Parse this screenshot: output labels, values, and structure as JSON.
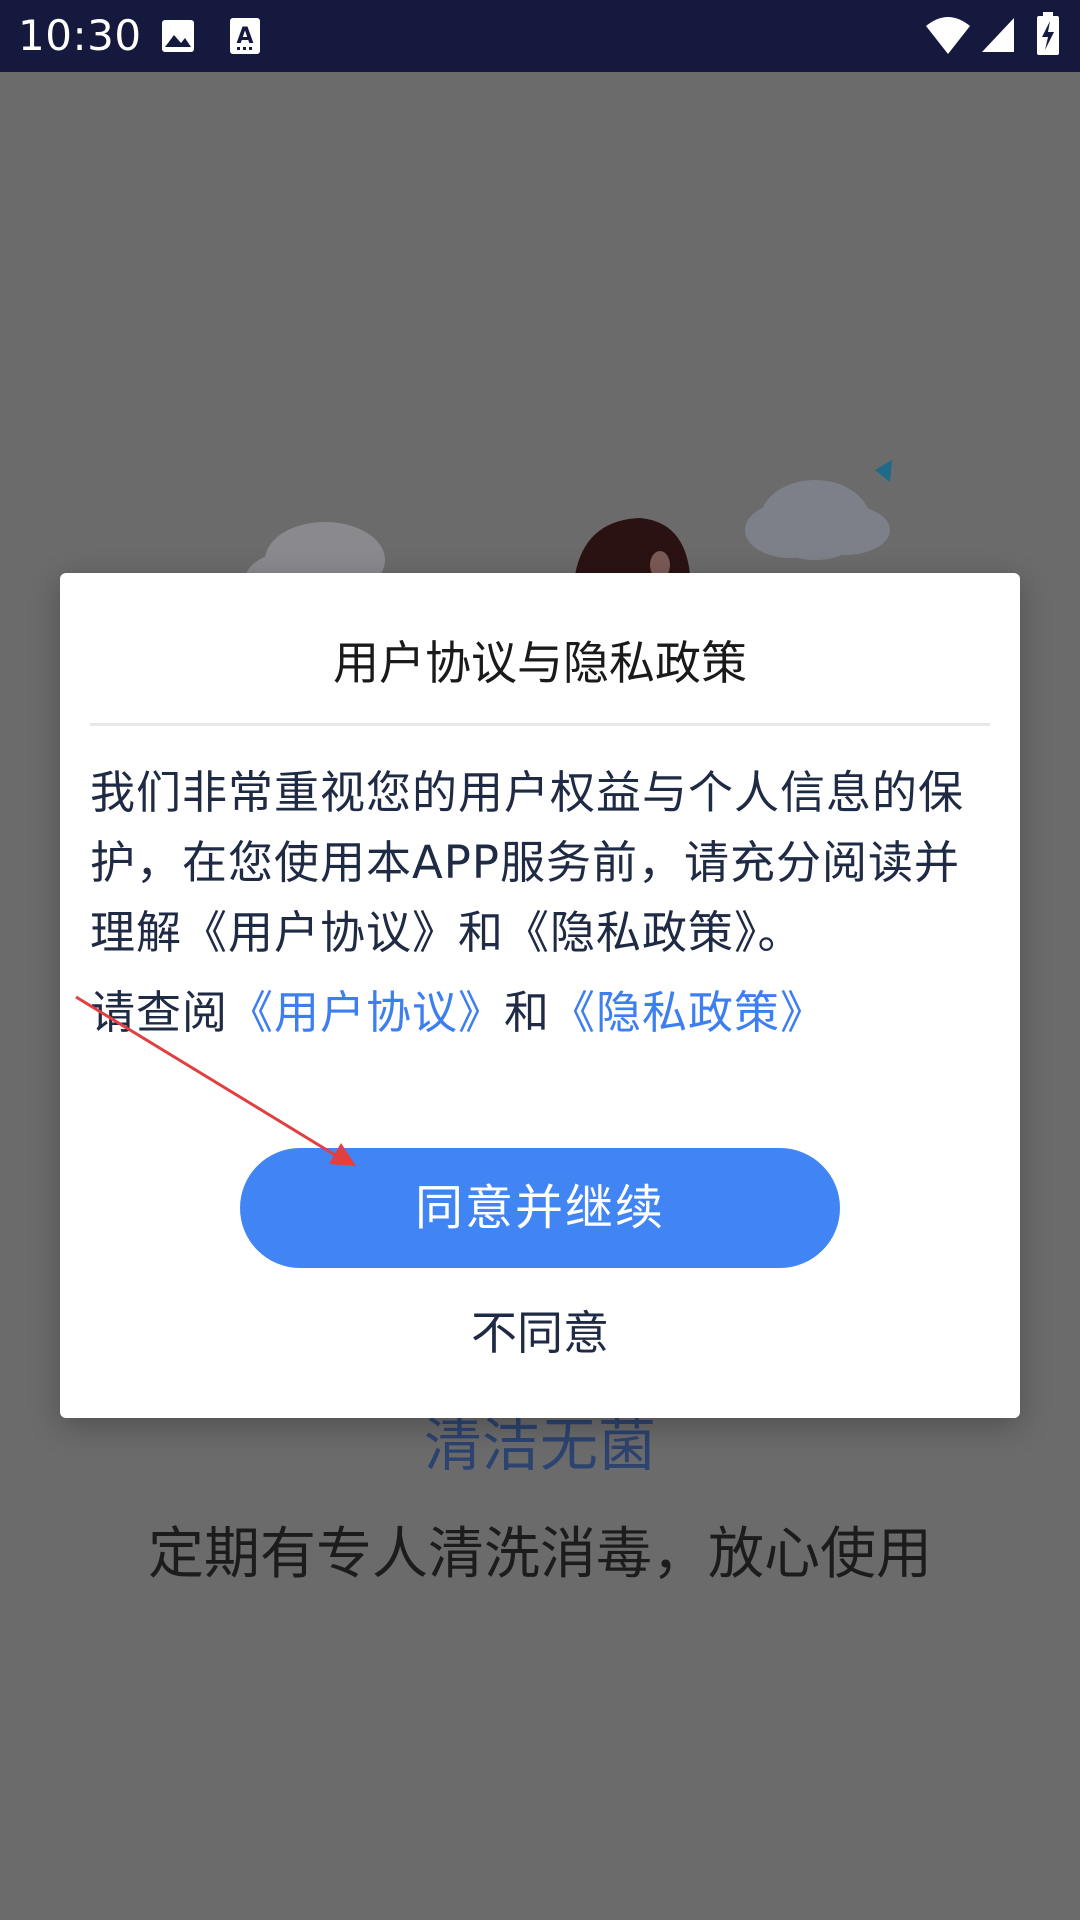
{
  "status_bar": {
    "time": "10:30",
    "icons": [
      "image-icon",
      "text-a-icon",
      "wifi-icon",
      "signal-icon",
      "battery-charging-icon"
    ]
  },
  "background": {
    "title": "清洁无菌",
    "subtitle": "定期有专人清洗消毒，放心使用",
    "overlay_color": "#6b6b6b"
  },
  "dialog": {
    "title": "用户协议与隐私政策",
    "body": "我们非常重视您的用户权益与个人信息的保护，在您使用本APP服务前，请充分阅读并理解《用户协议》和《隐私政策》。",
    "links_prefix": "请查阅",
    "user_agreement_link": "《用户协议》",
    "links_and": "和",
    "privacy_policy_link": "《隐私政策》",
    "agree_label": "同意并继续",
    "disagree_label": "不同意"
  },
  "colors": {
    "accent": "#4185f5",
    "link": "#3d7ff0",
    "status_bar": "#15193d",
    "annotation": "#e04040"
  }
}
